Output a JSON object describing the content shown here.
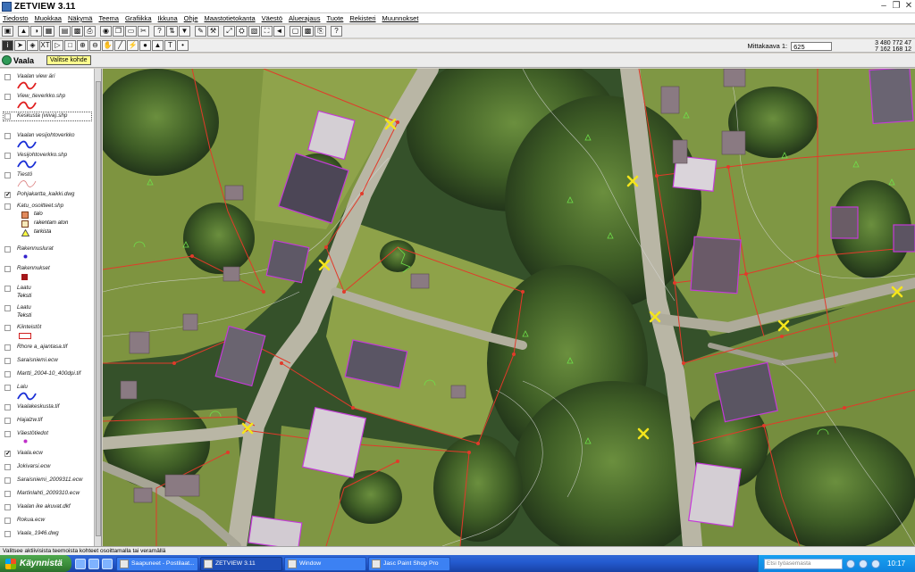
{
  "window": {
    "title": "ZETVIEW 3.11"
  },
  "menu": [
    "Tiedosto",
    "Muokkaa",
    "Näkymä",
    "Teema",
    "Grafiikka",
    "Ikkuna",
    "Ohje",
    "Maastotietokanta",
    "Väestö",
    "Aluerajaus",
    "Tuote",
    "Rekisteri",
    "Muunnokset"
  ],
  "toolbar": {
    "scale_label": "Mittakaava 1:",
    "scale_value": "625",
    "coord_x": "3 480 772 47",
    "coord_y": "7 162 168 12"
  },
  "view": {
    "name": "Vaala",
    "tooltip": "Valitse kohde"
  },
  "legend": [
    {
      "label": "Vaalan view äri",
      "checked": false
    },
    {
      "label": "View_tieverkko.shp",
      "checked": false
    },
    {
      "label": "Keskusta (viiva).shp",
      "checked": false,
      "selected": true
    },
    {
      "label": "Vaalan vesijohtoverkko",
      "checked": false
    },
    {
      "label": "Vesijohtoverkko.shp",
      "checked": false
    },
    {
      "label": "Tiestö",
      "checked": false
    },
    {
      "label": "Pohjakartta_kaikki.dwg",
      "checked": true
    },
    {
      "label": "Katu_osoitteet.shp",
      "checked": false,
      "subs": [
        "talo",
        "rakentam aton",
        "tarkista"
      ]
    },
    {
      "label": "Rakennuslurat",
      "checked": false
    },
    {
      "label": "Rakennukset",
      "checked": false
    },
    {
      "label": "Laatu",
      "checked": false,
      "sub": "Teksti"
    },
    {
      "label": "Laatu",
      "checked": false,
      "sub": "Teksti"
    },
    {
      "label": "Kiinteistöt",
      "checked": false
    },
    {
      "label": "Rhore a_ajantasa.tif",
      "checked": false
    },
    {
      "label": "Saraisniemi.ecw",
      "checked": false
    },
    {
      "label": "Martti_2004-10_400dpi.tif",
      "checked": false
    },
    {
      "label": "Lalu",
      "checked": false
    },
    {
      "label": "Vaalakeskusta.tif",
      "checked": false
    },
    {
      "label": "Hajalzw.tif",
      "checked": false
    },
    {
      "label": "Väestötiedot",
      "checked": false
    },
    {
      "label": "Vaala.ecw",
      "checked": true
    },
    {
      "label": "Jokivarsi.ecw",
      "checked": false
    },
    {
      "label": "Saraisniemi_2009311.ecw",
      "checked": false
    },
    {
      "label": "Martinlahti_2009310.ecw",
      "checked": false
    },
    {
      "label": "Vaalan ike akuvat.dkf",
      "checked": false
    },
    {
      "label": "Rokua.ecw",
      "checked": false
    },
    {
      "label": "Vaala_1946.dwg",
      "checked": false
    }
  ],
  "status": {
    "text": "Valitsee aktiivisista teemoista kohteet osoittamalla tai veramällä"
  },
  "taskbar": {
    "start": "Käynnistä",
    "tasks": [
      "Saapuneet - Postilaat...",
      "ZETVIEW 3.11",
      "Window",
      "Jasc Paint Shop Pro"
    ],
    "search_placeholder": "Etsi työasemasta",
    "clock": "10:17"
  },
  "colors": {
    "boundary": "#e23a2a",
    "building_outline": "#c43ad8",
    "address_marker": "#f4e41c",
    "contour": "#d8d8d8",
    "taskbar": "#245bd0"
  }
}
